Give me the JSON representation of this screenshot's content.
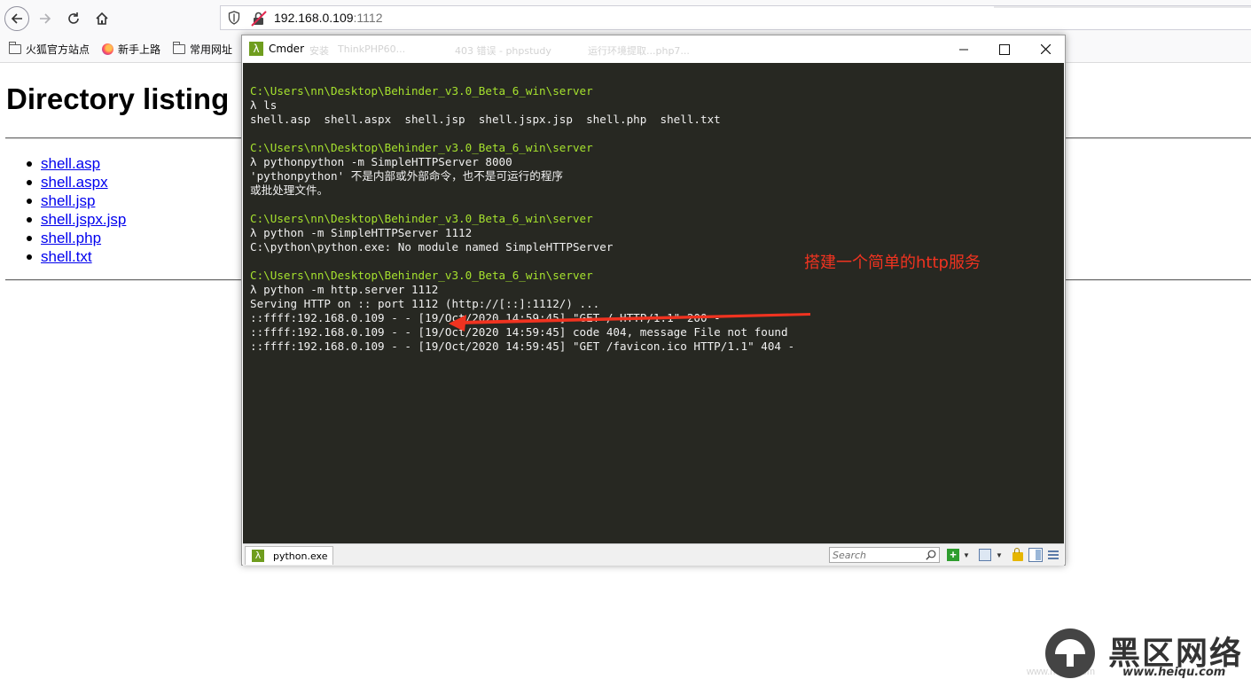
{
  "browser": {
    "url_host": "192.168.0.109",
    "url_port": ":1112",
    "bookmarks": [
      {
        "label": "火狐官方站点",
        "icon": "folder-icon"
      },
      {
        "label": "新手上路",
        "icon": "firefox-icon"
      },
      {
        "label": "常用网址",
        "icon": "folder-icon"
      }
    ],
    "faded_bookmarks": [
      "安装",
      "ThinkPHP60...",
      "403 错误 - phpstudy",
      "运行环境提取...php7..."
    ]
  },
  "page": {
    "title": "Directory listing",
    "title_slash": "/",
    "files": [
      "shell.asp",
      "shell.aspx",
      "shell.jsp",
      "shell.jspx.jsp",
      "shell.php",
      "shell.txt"
    ]
  },
  "cmder": {
    "title": "Cmder",
    "lines": [
      {
        "text": "C:\\Users\\nn\\Desktop\\Behinder_v3.0_Beta_6_win\\server",
        "kind": "path"
      },
      {
        "text": "λ ls",
        "kind": "cmd"
      },
      {
        "text": "shell.asp  shell.aspx  shell.jsp  shell.jspx.jsp  shell.php  shell.txt",
        "kind": "out"
      },
      {
        "text": "",
        "kind": "out"
      },
      {
        "text": "C:\\Users\\nn\\Desktop\\Behinder_v3.0_Beta_6_win\\server",
        "kind": "path"
      },
      {
        "text": "λ pythonpython -m SimpleHTTPServer 8000",
        "kind": "cmd"
      },
      {
        "text": "'pythonpython' 不是内部或外部命令，也不是可运行的程序",
        "kind": "out"
      },
      {
        "text": "或批处理文件。",
        "kind": "out"
      },
      {
        "text": "",
        "kind": "out"
      },
      {
        "text": "C:\\Users\\nn\\Desktop\\Behinder_v3.0_Beta_6_win\\server",
        "kind": "path"
      },
      {
        "text": "λ python -m SimpleHTTPServer 1112",
        "kind": "cmd"
      },
      {
        "text": "C:\\python\\python.exe: No module named SimpleHTTPServer",
        "kind": "out"
      },
      {
        "text": "",
        "kind": "out"
      },
      {
        "text": "C:\\Users\\nn\\Desktop\\Behinder_v3.0_Beta_6_win\\server",
        "kind": "path"
      },
      {
        "text": "λ python -m http.server 1112",
        "kind": "cmd"
      },
      {
        "text": "Serving HTTP on :: port 1112 (http://[::]:1112/) ...",
        "kind": "out"
      },
      {
        "text": "::ffff:192.168.0.109 - - [19/Oct/2020 14:59:45] \"GET / HTTP/1.1\" 200 -",
        "kind": "out"
      },
      {
        "text": "::ffff:192.168.0.109 - - [19/Oct/2020 14:59:45] code 404, message File not found",
        "kind": "out"
      },
      {
        "text": "::ffff:192.168.0.109 - - [19/Oct/2020 14:59:45] \"GET /favicon.ico HTTP/1.1\" 404 -",
        "kind": "out"
      }
    ],
    "annotation": "搭建一个简单的http服务",
    "tab_label": "python.exe",
    "search_placeholder": "Search",
    "colors": {
      "background": "#272822",
      "path": "#a6e22e",
      "text": "#f0f0f0",
      "annotation": "#f03320"
    }
  },
  "watermark": {
    "brand": "黑区网络",
    "url": "www.heiqu.com"
  }
}
